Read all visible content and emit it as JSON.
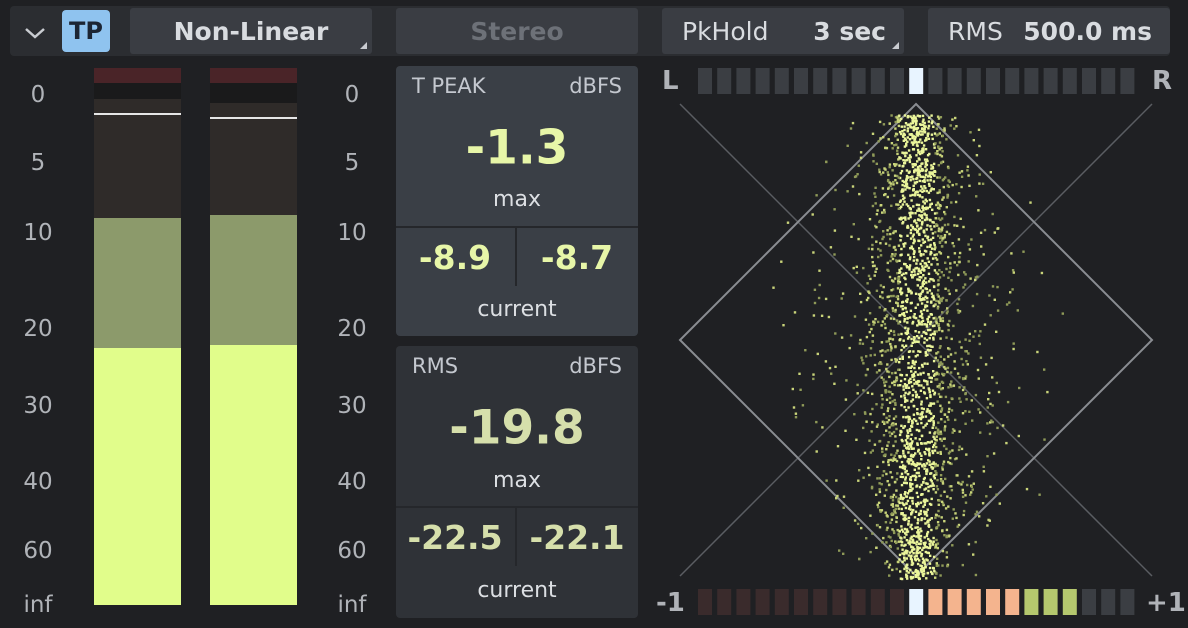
{
  "toolbar": {
    "collapse_icon": "chevron-down-icon",
    "tp_label": "TP",
    "scale_mode": "Non-Linear",
    "channel_mode": "Stereo",
    "pkhold_label": "PkHold",
    "pkhold_value": "3 sec",
    "rms_label": "RMS",
    "rms_value": "500.0 ms"
  },
  "scale_labels": [
    "0",
    "5",
    "10",
    "20",
    "30",
    "40",
    "60",
    "inf"
  ],
  "meters": [
    {
      "channel": "L",
      "hold_db": -1.3,
      "peak_db": -8.9,
      "rms_db": -22.5
    },
    {
      "channel": "R",
      "hold_db": -1.6,
      "peak_db": -8.7,
      "rms_db": -22.1
    }
  ],
  "true_peak": {
    "header": "T PEAK",
    "unit": "dBFS",
    "max_value": "-1.3",
    "max_label": "max",
    "current_left": "-8.9",
    "current_right": "-8.7",
    "current_label": "current"
  },
  "rms": {
    "header": "RMS",
    "unit": "dBFS",
    "max_value": "-19.8",
    "max_label": "max",
    "current_left": "-22.5",
    "current_right": "-22.1",
    "current_label": "current"
  },
  "goniometer": {
    "left_label": "L",
    "right_label": "R",
    "balance": 0.0,
    "correlation": 0.72,
    "corr_min_label": "-1",
    "corr_max_label": "+1"
  },
  "colors": {
    "meter_bright": "#e1fd8b",
    "meter_mid": "#8c9a6b",
    "meter_dark": "#2f2b29",
    "clip": "#4a2428",
    "tp_accent": "#8fc3ef",
    "value_text": "#e7f6a8"
  }
}
